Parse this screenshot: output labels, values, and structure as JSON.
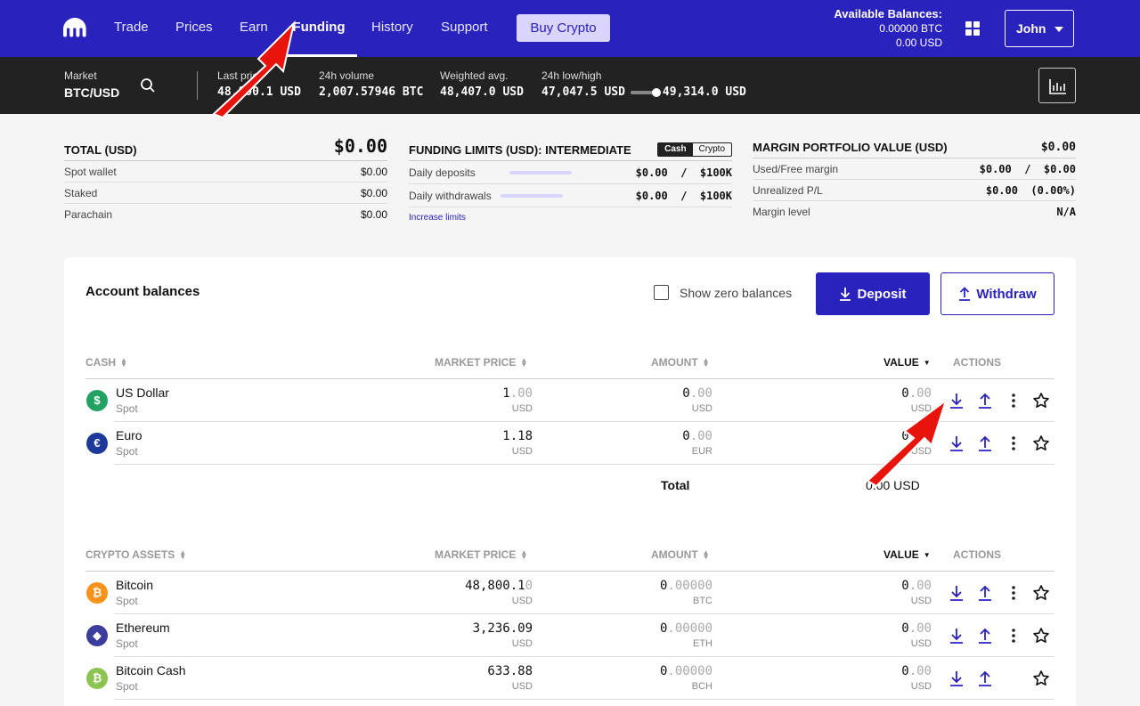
{
  "nav": {
    "items": [
      "Trade",
      "Prices",
      "Earn",
      "Funding",
      "History",
      "Support"
    ],
    "active": "Funding",
    "buy_label": "Buy Crypto",
    "balances_title": "Available Balances:",
    "balance_btc": "0.00000 BTC",
    "balance_usd": "0.00 USD",
    "user": "John"
  },
  "market": {
    "label": "Market",
    "pair": "BTC/USD",
    "last_label": "Last price",
    "last_value": "48,800.1 USD",
    "volume_label": "24h volume",
    "volume_value": "2,007.57946 BTC",
    "wavg_label": "Weighted avg.",
    "wavg_value": "48,407.0 USD",
    "lowhigh_label": "24h low/high",
    "low_value": "47,047.5 USD",
    "high_value": "49,314.0 USD"
  },
  "total_panel": {
    "title": "TOTAL (USD)",
    "value": "$0.00",
    "rows": [
      {
        "label": "Spot wallet",
        "value": "$0.00"
      },
      {
        "label": "Staked",
        "value": "$0.00"
      },
      {
        "label": "Parachain",
        "value": "$0.00"
      }
    ]
  },
  "limits_panel": {
    "title": "FUNDING LIMITS (USD): INTERMEDIATE",
    "toggle": [
      "Cash",
      "Crypto"
    ],
    "rows": [
      {
        "label": "Daily deposits",
        "value": "$0.00  /  $100K"
      },
      {
        "label": "Daily withdrawals",
        "value": "$0.00  /  $100K"
      }
    ],
    "link": "Increase limits"
  },
  "margin_panel": {
    "title": "MARGIN PORTFOLIO VALUE (USD)",
    "value": "$0.00",
    "rows": [
      {
        "label": "Used/Free margin",
        "value": "$0.00  /  $0.00"
      },
      {
        "label": "Unrealized P/L",
        "value": "$0.00  (0.00%)"
      },
      {
        "label": "Margin level",
        "value": "N/A"
      }
    ]
  },
  "balances": {
    "title": "Account balances",
    "show_zero_label": "Show zero balances",
    "deposit_label": "Deposit",
    "withdraw_label": "Withdraw",
    "cash_headers": [
      "CASH",
      "MARKET PRICE",
      "AMOUNT",
      "VALUE",
      "ACTIONS"
    ],
    "crypto_headers": [
      "CRYPTO ASSETS",
      "MARKET PRICE",
      "AMOUNT",
      "VALUE",
      "ACTIONS"
    ],
    "cash_rows": [
      {
        "name": "US Dollar",
        "type": "Spot",
        "price_main": "1",
        "price_dim": ".00",
        "price_unit": "USD",
        "amount_main": "0",
        "amount_dim": ".00",
        "amount_unit": "USD",
        "value_main": "0",
        "value_dim": ".00",
        "value_unit": "USD",
        "symbol": "$",
        "color": "#21a162"
      },
      {
        "name": "Euro",
        "type": "Spot",
        "price_main": "1.18",
        "price_dim": "",
        "price_unit": "USD",
        "amount_main": "0",
        "amount_dim": ".00",
        "amount_unit": "EUR",
        "value_main": "0",
        "value_dim": ".00",
        "value_unit": "USD",
        "symbol": "€",
        "color": "#1d3a9a"
      }
    ],
    "total_label": "Total",
    "total_value": "0.00 USD",
    "crypto_rows": [
      {
        "name": "Bitcoin",
        "type": "Spot",
        "price_main": "48,800.1",
        "price_dim": "0",
        "price_unit": "USD",
        "amount_main": "0",
        "amount_dim": ".00000",
        "amount_unit": "BTC",
        "value_main": "0",
        "value_dim": ".00",
        "value_unit": "USD",
        "symbol": "₿",
        "color": "#f7931a"
      },
      {
        "name": "Ethereum",
        "type": "Spot",
        "price_main": "3,236.09",
        "price_dim": "",
        "price_unit": "USD",
        "amount_main": "0",
        "amount_dim": ".00000",
        "amount_unit": "ETH",
        "value_main": "0",
        "value_dim": ".00",
        "value_unit": "USD",
        "symbol": "◆",
        "color": "#3c3c9c"
      },
      {
        "name": "Bitcoin Cash",
        "type": "Spot",
        "price_main": "633.88",
        "price_dim": "",
        "price_unit": "USD",
        "amount_main": "0",
        "amount_dim": ".00000",
        "amount_unit": "BCH",
        "value_main": "0",
        "value_dim": ".00",
        "value_unit": "USD",
        "symbol": "₿",
        "color": "#8dc351"
      }
    ]
  }
}
